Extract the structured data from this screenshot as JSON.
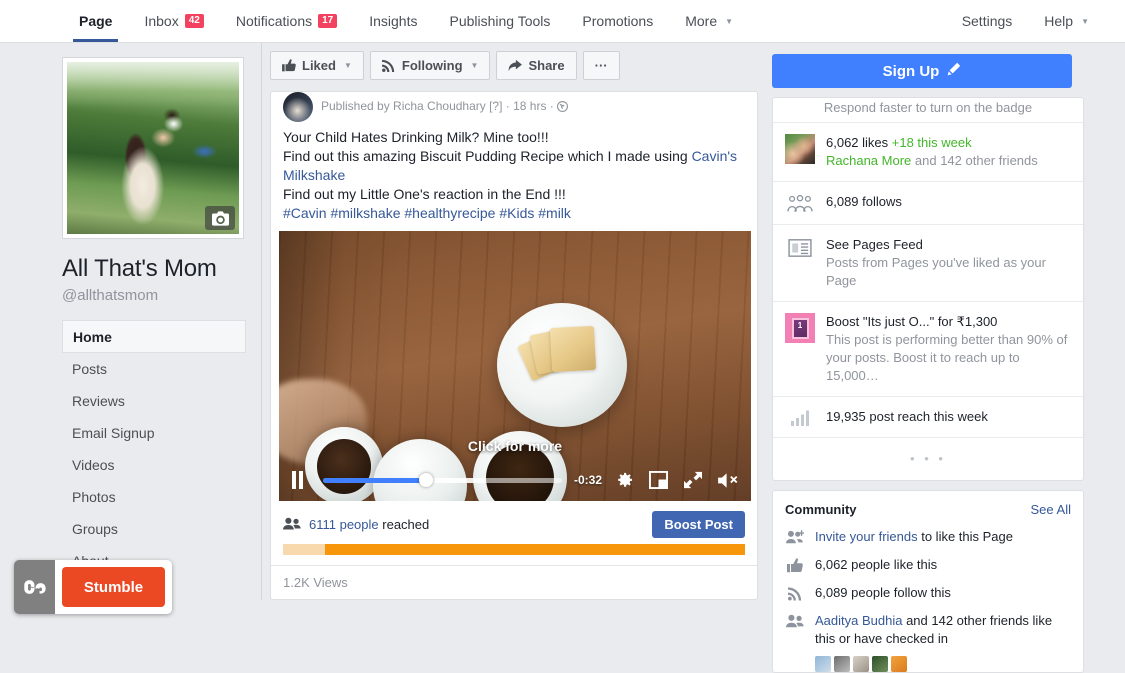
{
  "topnav": {
    "left_items": [
      {
        "label": "Page",
        "badge": null,
        "caret": false,
        "active": true
      },
      {
        "label": "Inbox",
        "badge": "42",
        "caret": false,
        "active": false
      },
      {
        "label": "Notifications",
        "badge": "17",
        "caret": false,
        "active": false
      },
      {
        "label": "Insights",
        "badge": null,
        "caret": false,
        "active": false
      },
      {
        "label": "Publishing Tools",
        "badge": null,
        "caret": false,
        "active": false
      },
      {
        "label": "Promotions",
        "badge": null,
        "caret": false,
        "active": false
      },
      {
        "label": "More",
        "badge": null,
        "caret": true,
        "active": false
      }
    ],
    "right_items": [
      {
        "label": "Settings",
        "caret": false
      },
      {
        "label": "Help",
        "caret": true
      }
    ]
  },
  "sidebar": {
    "page_name": "All That's Mom",
    "page_handle": "@allthatsmom",
    "items": [
      {
        "label": "Home",
        "active": true
      },
      {
        "label": "Posts",
        "active": false
      },
      {
        "label": "Reviews",
        "active": false
      },
      {
        "label": "Email Signup",
        "active": false
      },
      {
        "label": "Videos",
        "active": false
      },
      {
        "label": "Photos",
        "active": false
      },
      {
        "label": "Groups",
        "active": false
      },
      {
        "label": "About",
        "active": false
      }
    ],
    "stumble": {
      "logo": "su",
      "label": "Stumble"
    }
  },
  "actionbar": {
    "liked": "Liked",
    "following": "Following",
    "share": "Share",
    "more": "···"
  },
  "post": {
    "published_by": "Published by Richa Choudhary [?] · 18 hrs ·",
    "line1": "Your Child Hates Drinking Milk? Mine too!!!",
    "line2a": "Find out this amazing Biscuit Pudding Recipe which I made using ",
    "line2b": "Cavin's Milkshake",
    "line3": "Find out my Little One's reaction in the End !!!",
    "hashtags": "#Cavin #milkshake #healthyrecipe #Kids #milk",
    "video": {
      "overlay_text": "Click for more",
      "time_remaining": "-0:32",
      "progress_percent": 43,
      "buffered_percent": 68,
      "muted": true,
      "playing": true
    },
    "reach_count": "6111 people",
    "reach_suffix": "reached",
    "boost_label": "Boost Post",
    "reach_progress_percent": 91,
    "views": "1.2K Views"
  },
  "rightcol": {
    "signup_label": "Sign Up",
    "badge_note": "Respond faster to turn on the badge",
    "likes_line1_a": "6,062 likes ",
    "likes_line1_b": "+18 this week",
    "likes_line2_a": "Rachana More",
    "likes_line2_b": " and 142 other friends",
    "follows": "6,089 follows",
    "pages_feed_title": "See Pages Feed",
    "pages_feed_sub": "Posts from Pages you've liked as your Page",
    "boost_title": "Boost \"Its just O...\" for ₹1,300",
    "boost_sub": "This post is performing better than 90% of your posts. Boost it to reach up to 15,000…",
    "boost_thumb_number": "1",
    "post_reach": "19,935 post reach this week",
    "dots": "• • •",
    "community_title": "Community",
    "community_seeall": "See All",
    "community_rows": [
      {
        "link": "Invite your friends",
        "rest": " to like this Page",
        "icon": "invite-friends-icon"
      },
      {
        "link": "",
        "rest": "6,062 people like this",
        "icon": "thumbs-up-icon"
      },
      {
        "link": "",
        "rest": "6,089 people follow this",
        "icon": "rss-icon"
      },
      {
        "link": "Aaditya Budhia",
        "rest": " and 142 other friends like this or have checked in",
        "icon": "friends-icon"
      }
    ]
  },
  "colors": {
    "brand_blue": "#4267b2",
    "signup_blue": "#4080ff",
    "badge_red": "#f3425f",
    "orange": "#f7960a",
    "green": "#42b72a",
    "stumble_red": "#eb4924"
  }
}
